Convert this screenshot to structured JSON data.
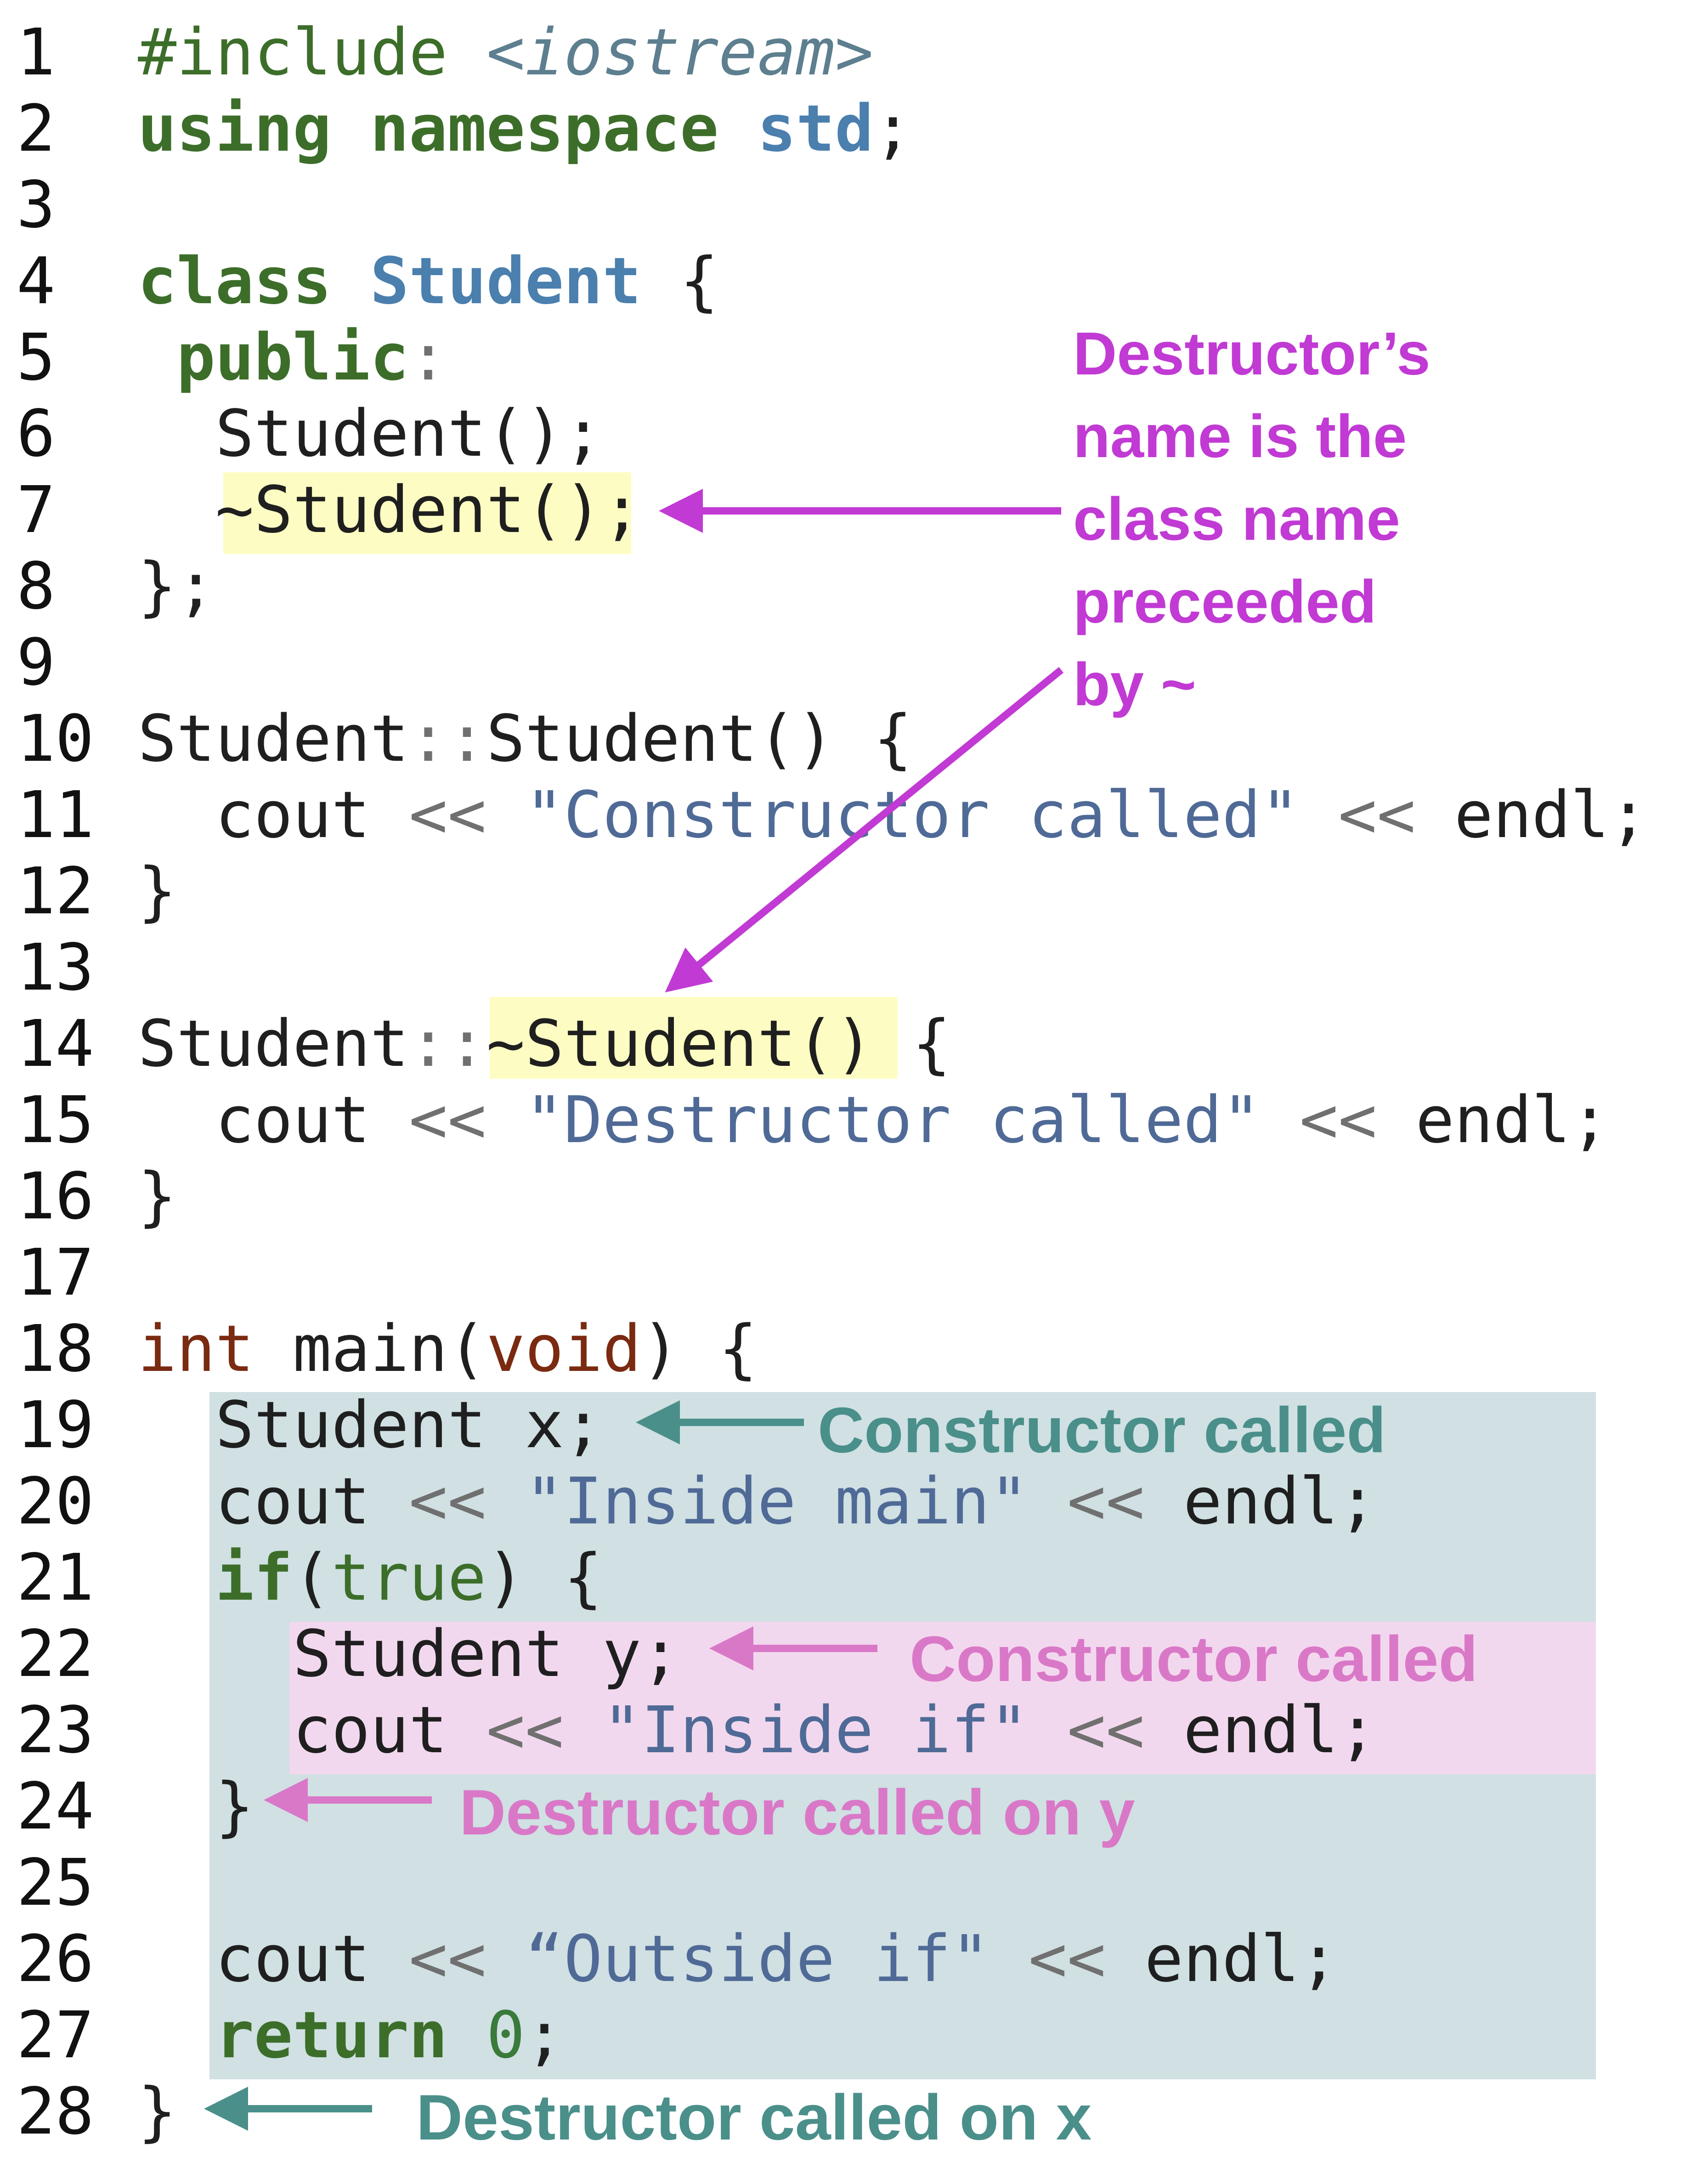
{
  "code": [
    {
      "n": "1",
      "parts": [
        {
          "t": "#include ",
          "c": "pp"
        },
        {
          "t": "<iostream>",
          "c": "inc"
        }
      ]
    },
    {
      "n": "2",
      "parts": [
        {
          "t": "using namespace ",
          "c": "kw"
        },
        {
          "t": "std",
          "c": "cls"
        },
        {
          "t": ";",
          "c": ""
        }
      ]
    },
    {
      "n": "3",
      "parts": []
    },
    {
      "n": "4",
      "parts": [
        {
          "t": "class ",
          "c": "kw"
        },
        {
          "t": "Student",
          "c": "cls"
        },
        {
          "t": " {",
          "c": ""
        }
      ]
    },
    {
      "n": "5",
      "parts": [
        {
          "t": " ",
          "c": ""
        },
        {
          "t": "public",
          "c": "kw"
        },
        {
          "t": ":",
          "c": "op"
        }
      ]
    },
    {
      "n": "6",
      "parts": [
        {
          "t": "  Student();",
          "c": ""
        }
      ]
    },
    {
      "n": "7",
      "parts": [
        {
          "t": "  ~Student();",
          "c": ""
        }
      ]
    },
    {
      "n": "8",
      "parts": [
        {
          "t": "};",
          "c": ""
        }
      ]
    },
    {
      "n": "9",
      "parts": []
    },
    {
      "n": "10",
      "parts": [
        {
          "t": "Student",
          "c": ""
        },
        {
          "t": "::",
          "c": "op"
        },
        {
          "t": "Student() {",
          "c": ""
        }
      ]
    },
    {
      "n": "11",
      "parts": [
        {
          "t": "  cout ",
          "c": ""
        },
        {
          "t": "<<",
          "c": "op"
        },
        {
          "t": " ",
          "c": ""
        },
        {
          "t": "\"Constructor called\"",
          "c": "str"
        },
        {
          "t": " ",
          "c": ""
        },
        {
          "t": "<<",
          "c": "op"
        },
        {
          "t": " endl;",
          "c": ""
        }
      ]
    },
    {
      "n": "12",
      "parts": [
        {
          "t": "}",
          "c": ""
        }
      ]
    },
    {
      "n": "13",
      "parts": []
    },
    {
      "n": "14",
      "parts": [
        {
          "t": "Student",
          "c": ""
        },
        {
          "t": "::",
          "c": "op"
        },
        {
          "t": "~Student() {",
          "c": ""
        }
      ]
    },
    {
      "n": "15",
      "parts": [
        {
          "t": "  cout ",
          "c": ""
        },
        {
          "t": "<<",
          "c": "op"
        },
        {
          "t": " ",
          "c": ""
        },
        {
          "t": "\"Destructor called\"",
          "c": "str"
        },
        {
          "t": " ",
          "c": ""
        },
        {
          "t": "<<",
          "c": "op"
        },
        {
          "t": " endl;",
          "c": ""
        }
      ]
    },
    {
      "n": "16",
      "parts": [
        {
          "t": "}",
          "c": ""
        }
      ]
    },
    {
      "n": "17",
      "parts": []
    },
    {
      "n": "18",
      "parts": [
        {
          "t": "int",
          "c": "typ"
        },
        {
          "t": " main(",
          "c": ""
        },
        {
          "t": "void",
          "c": "typ"
        },
        {
          "t": ") {",
          "c": ""
        }
      ]
    },
    {
      "n": "19",
      "parts": [
        {
          "t": "  Student x;",
          "c": ""
        }
      ]
    },
    {
      "n": "20",
      "parts": [
        {
          "t": "  cout ",
          "c": ""
        },
        {
          "t": "<<",
          "c": "op"
        },
        {
          "t": " ",
          "c": ""
        },
        {
          "t": "\"Inside main\"",
          "c": "str"
        },
        {
          "t": " ",
          "c": ""
        },
        {
          "t": "<<",
          "c": "op"
        },
        {
          "t": " endl;",
          "c": ""
        }
      ]
    },
    {
      "n": "21",
      "parts": [
        {
          "t": "  ",
          "c": ""
        },
        {
          "t": "if",
          "c": "kw"
        },
        {
          "t": "(",
          "c": ""
        },
        {
          "t": "true",
          "c": "bool"
        },
        {
          "t": ") {",
          "c": ""
        }
      ]
    },
    {
      "n": "22",
      "parts": [
        {
          "t": "    Student y;",
          "c": ""
        }
      ]
    },
    {
      "n": "23",
      "parts": [
        {
          "t": "    cout ",
          "c": ""
        },
        {
          "t": "<<",
          "c": "op"
        },
        {
          "t": " ",
          "c": ""
        },
        {
          "t": "\"Inside if\"",
          "c": "str"
        },
        {
          "t": " ",
          "c": ""
        },
        {
          "t": "<<",
          "c": "op"
        },
        {
          "t": " endl;",
          "c": ""
        }
      ]
    },
    {
      "n": "24",
      "parts": [
        {
          "t": "  }",
          "c": ""
        }
      ]
    },
    {
      "n": "25",
      "parts": []
    },
    {
      "n": "26",
      "parts": [
        {
          "t": "  cout ",
          "c": ""
        },
        {
          "t": "<<",
          "c": "op"
        },
        {
          "t": " ",
          "c": ""
        },
        {
          "t": "“Outside if\"",
          "c": "str"
        },
        {
          "t": " ",
          "c": ""
        },
        {
          "t": "<<",
          "c": "op"
        },
        {
          "t": " endl;",
          "c": ""
        }
      ]
    },
    {
      "n": "27",
      "parts": [
        {
          "t": "  ",
          "c": ""
        },
        {
          "t": "return",
          "c": "kw"
        },
        {
          "t": " ",
          "c": ""
        },
        {
          "t": "0",
          "c": "num"
        },
        {
          "t": ";",
          "c": ""
        }
      ]
    },
    {
      "n": "28",
      "parts": [
        {
          "t": "}",
          "c": ""
        }
      ]
    }
  ],
  "annotations": {
    "destructor_note": "Destructor’s\nname is the\nclass name\npreceeded\nby ~",
    "ctor_x": "Constructor called",
    "ctor_y": "Constructor called",
    "dtor_y": "Destructor called on y",
    "dtor_x": "Destructor called on x"
  },
  "colors": {
    "destructor_note": "#c13ad4",
    "teal_note": "#4a8f8a",
    "pink_note": "#da78c8",
    "main_scope_bg": "#d0e0e3",
    "if_scope_bg": "#f2d8ee",
    "destructor_highlight": "#fdfdc3"
  }
}
